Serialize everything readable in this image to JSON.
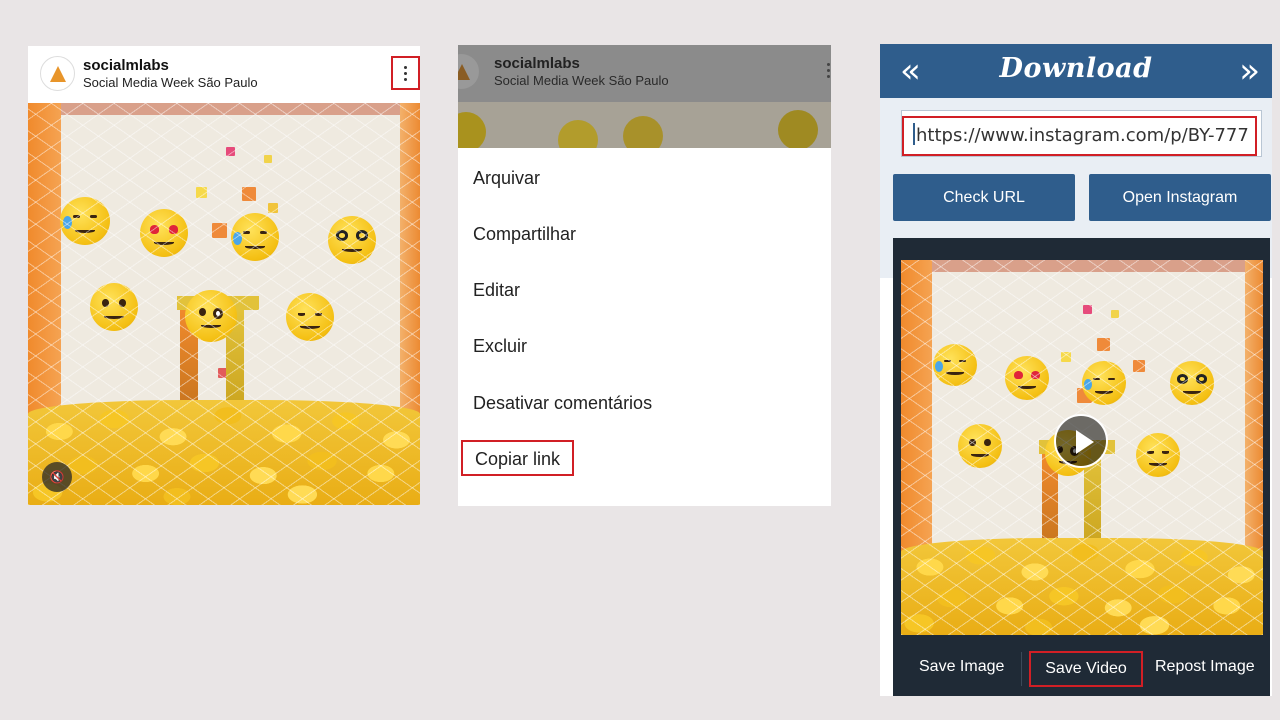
{
  "panel1": {
    "username": "socialmlabs",
    "location": "Social Media Week São Paulo",
    "avatar_icon": "flask-logo-icon",
    "menu_icon": "kebab-menu-icon",
    "mute_icon": "speaker-muted-icon"
  },
  "panel2": {
    "username": "socialmlabs",
    "location": "Social Media Week São Paulo",
    "menu_items": [
      "Arquivar",
      "Compartilhar",
      "Editar",
      "Excluir",
      "Desativar comentários",
      "Copiar link"
    ],
    "highlighted_item": "Copiar link"
  },
  "panel3": {
    "title": "Download",
    "nav_back": "«",
    "nav_forward": "»",
    "url_value": "https://www.instagram.com/p/BY-777",
    "check_url_label": "Check URL",
    "open_instagram_label": "Open Instagram",
    "play_icon": "play-icon",
    "actions": [
      "Save Image",
      "Save Video",
      "Repost Image"
    ],
    "highlighted_action": "Save Video"
  },
  "colors": {
    "accent_blue": "#2f5d8c",
    "highlight_red": "#d11f25",
    "page_bg": "#e9e5e6",
    "player_bg": "#1f2a36"
  }
}
